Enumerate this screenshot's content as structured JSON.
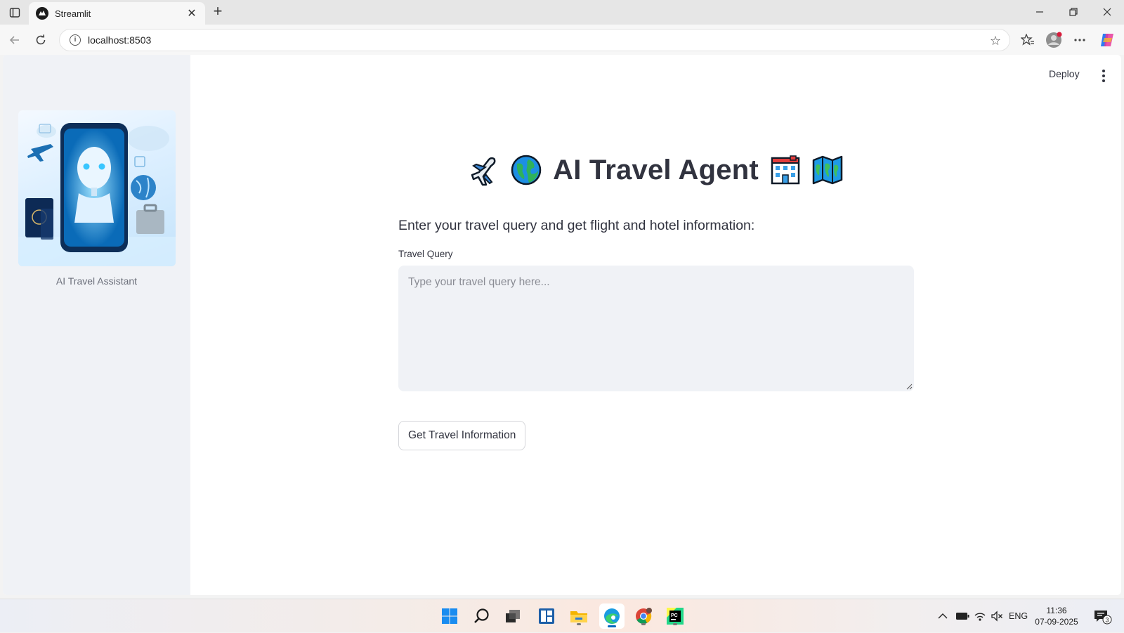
{
  "browser": {
    "tab_title": "Streamlit",
    "url": "localhost:8503"
  },
  "sidebar": {
    "image_name": "ai-travel-assistant-image",
    "caption": "AI Travel Assistant"
  },
  "header": {
    "deploy_label": "Deploy"
  },
  "main": {
    "title": "AI Travel Agent",
    "title_icons_left": [
      "airplane-icon",
      "globe-icon"
    ],
    "title_icons_right": [
      "hotel-icon",
      "map-icon"
    ],
    "subheader": "Enter your travel query and get flight and hotel information:",
    "query_label": "Travel Query",
    "query_placeholder": "Type your travel query here...",
    "query_value": "",
    "submit_label": "Get Travel Information"
  },
  "taskbar": {
    "apps": [
      "start-icon",
      "search-icon",
      "task-view-icon",
      "widgets-icon",
      "file-explorer-icon",
      "edge-icon",
      "chrome-icon",
      "pycharm-icon"
    ],
    "tray_language": "ENG",
    "time": "11:36",
    "date": "07-09-2025",
    "notification_count": "3"
  },
  "colors": {
    "sidebar_bg": "#f0f2f6",
    "text": "#31333f",
    "accent": "#0067c0"
  }
}
